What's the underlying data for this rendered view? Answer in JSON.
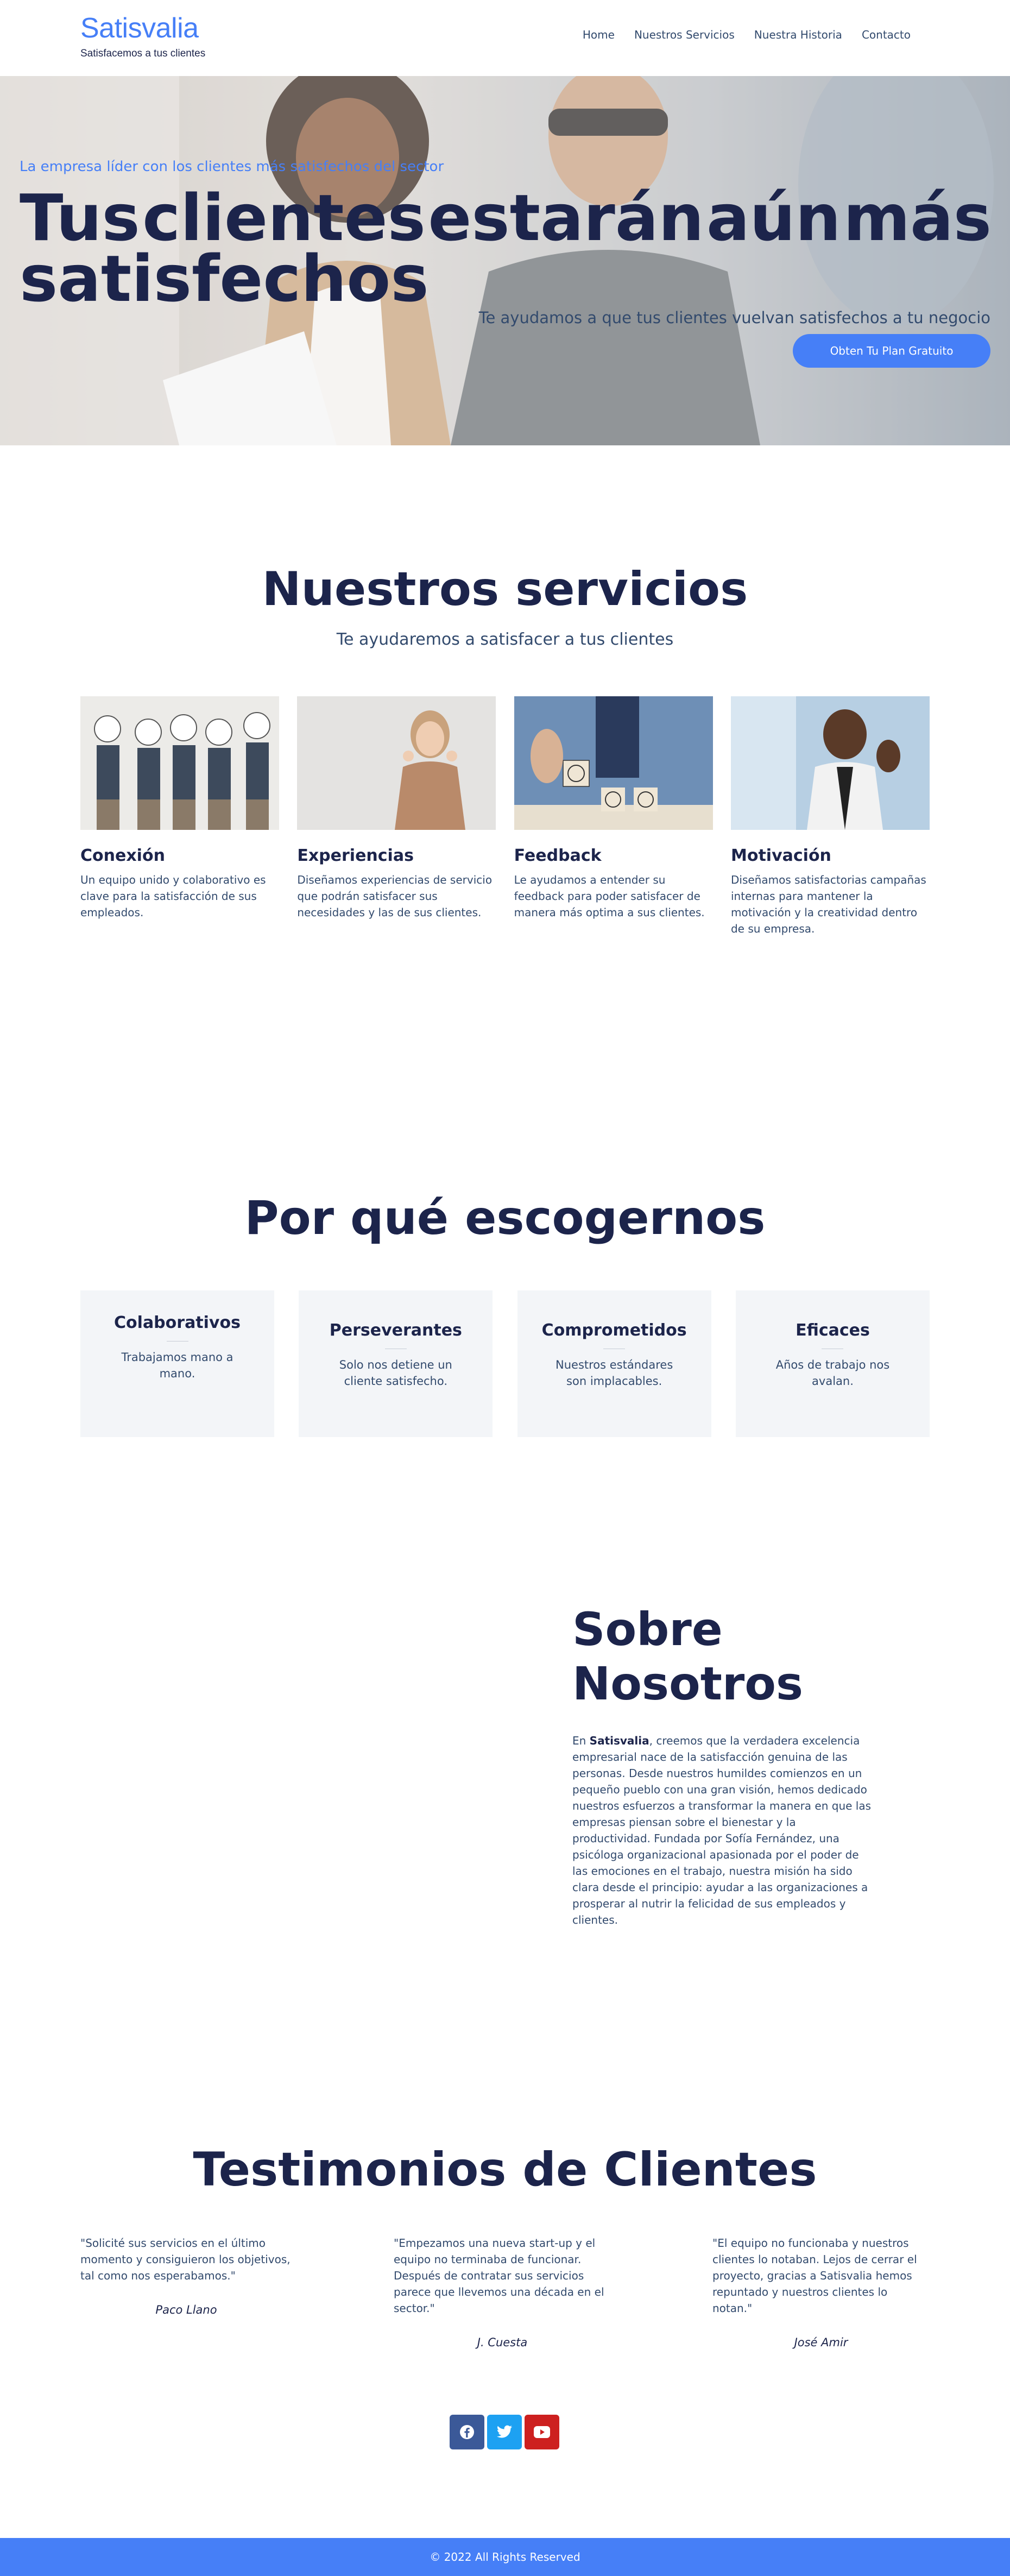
{
  "brand": {
    "name": "Satisvalia",
    "tagline": "Satisfacemos a tus clientes"
  },
  "nav": {
    "items": [
      "Home",
      "Nuestros Servicios",
      "Nuestra Historia",
      "Contacto"
    ]
  },
  "hero": {
    "eyebrow": "La empresa líder con los clientes más satisfechos del sector",
    "title_words_line1": [
      "Tus",
      "clientes",
      "estarán",
      "aún",
      "más"
    ],
    "title_line2": "satisfechos",
    "subtitle": "Te ayudamos a que tus clientes vuelvan satisfechos a tu negocio",
    "cta": "Obten Tu Plan Gratuito"
  },
  "services": {
    "title": "Nuestros servicios",
    "subtitle": "Te ayudaremos a satisfacer a tus clientes",
    "items": [
      {
        "title": "Conexión",
        "text": "Un equipo unido y colaborativo es clave para la satisfacción de sus empleados."
      },
      {
        "title": "Experiencias",
        "text": "Diseñamos experiencias de servicio que podrán satisfacer sus necesidades y las de sus clientes."
      },
      {
        "title": "Feedback",
        "text": "Le ayudamos a entender su feedback para poder satisfacer de manera más optima a sus clientes."
      },
      {
        "title": "Motivación",
        "text": "Diseñamos satisfactorias campañas internas para mantener la motivación y la creatividad dentro de su empresa."
      }
    ]
  },
  "why": {
    "title": "Por qué escogernos",
    "items": [
      {
        "title": "Colaborativos",
        "text": "Trabajamos mano a mano."
      },
      {
        "title": "Perseverantes",
        "text": "Solo nos detiene un cliente satisfecho."
      },
      {
        "title": "Comprometidos",
        "text": "Nuestros estándares son implacables."
      },
      {
        "title": "Eficaces",
        "text": "Años de trabajo nos avalan."
      }
    ]
  },
  "about": {
    "title": "Sobre Nosotros",
    "text_pre": "En ",
    "text_brand": "Satisvalia",
    "text_post": ", creemos que la verdadera excelencia empresarial nace de la satisfacción genuina de las personas. Desde nuestros humildes comienzos en un pequeño pueblo con una gran visión, hemos dedicado nuestros esfuerzos a transformar la manera en que las empresas piensan sobre el bienestar y la productividad. Fundada por Sofía Fernández, una psicóloga organizacional apasionada por el poder de las emociones en el trabajo, nuestra misión ha sido clara desde el principio: ayudar a las organizaciones a prosperar al nutrir la felicidad de sus empleados y clientes."
  },
  "testimonials": {
    "title": "Testimonios de Clientes",
    "items": [
      {
        "quote": "\"Solicité sus servicios en el último momento y consiguieron los objetivos, tal como nos esperabamos.\"",
        "author": "Paco Llano"
      },
      {
        "quote": "\"Empezamos una nueva start-up y el equipo no terminaba de funcionar. Después de contratar sus servicios parece que llevemos una década en el sector.\"",
        "author": "J. Cuesta"
      },
      {
        "quote": "\"El equipo no funcionaba y nuestros clientes lo notaban. Lejos de cerrar el proyecto, gracias a Satisvalia hemos repuntado y nuestros clientes lo notan.\"",
        "author": "José Amir"
      }
    ]
  },
  "social": {
    "items": [
      {
        "icon": "facebook-icon",
        "color": "#3b5998"
      },
      {
        "icon": "twitter-icon",
        "color": "#1da1f2"
      },
      {
        "icon": "youtube-icon",
        "color": "#cd201f"
      }
    ]
  },
  "footer": {
    "text": "© 2022 All Rights Reserved"
  },
  "colors": {
    "accent": "#467ff7",
    "heading": "#1c244b",
    "body": "#324a6d",
    "card_bg": "#f3f5f8"
  }
}
